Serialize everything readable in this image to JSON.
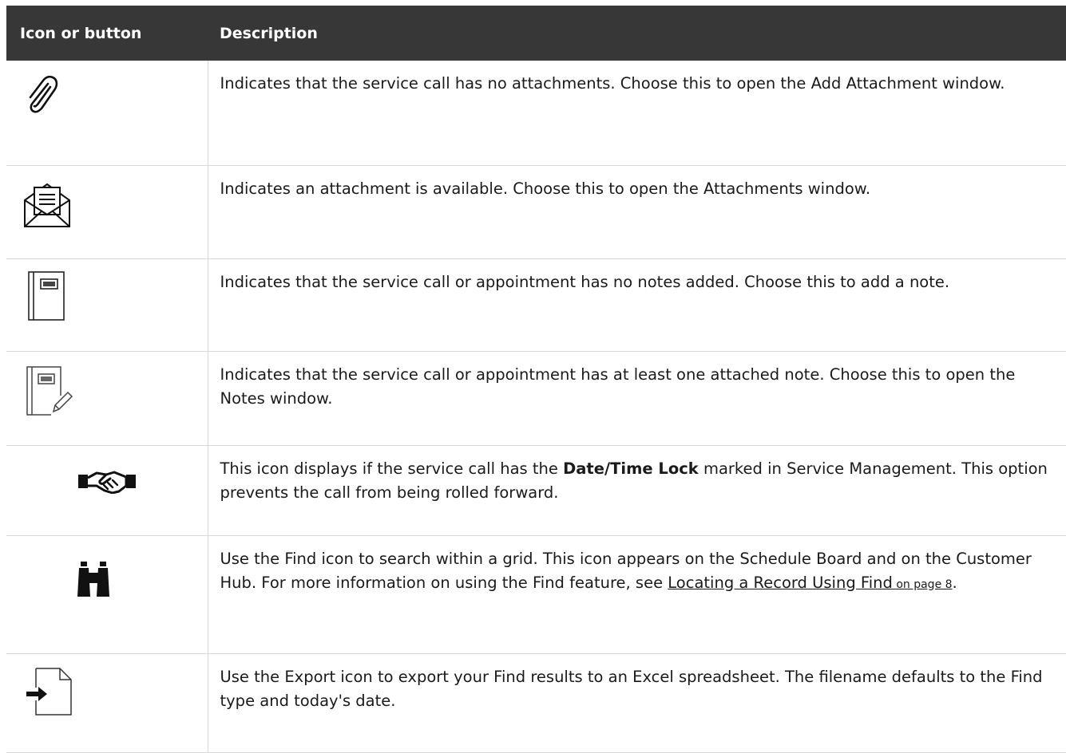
{
  "table": {
    "headers": {
      "icon": "Icon or button",
      "description": "Description"
    },
    "rows": [
      {
        "icon": "paperclip-icon",
        "description": "Indicates that the service call has no attachments. Choose this to open the Add Attachment window."
      },
      {
        "icon": "open-envelope-document-icon",
        "description": "Indicates an attachment is available. Choose this to open the Attachments window."
      },
      {
        "icon": "notebook-icon",
        "description": "Indicates that the service call or appointment has no notes added. Choose this to add a note."
      },
      {
        "icon": "notebook-pencil-icon",
        "description": "Indicates that the service call or appointment has at least one attached note. Choose this to open the Notes window."
      },
      {
        "icon": "handshake-icon",
        "description_before": "This icon displays if the service call has the ",
        "description_bold": "Date/Time Lock",
        "description_after": " marked in Service Management. This option prevents the call from being rolled forward."
      },
      {
        "icon": "binoculars-icon",
        "description_before": "Use the Find icon to search within a grid. This icon appears on the Schedule Board and on the Customer Hub. For more information on using the Find feature, see ",
        "link_text": "Locating a Record Using Find",
        "link_page": " on page 8",
        "description_after": "."
      },
      {
        "icon": "export-document-arrow-icon",
        "description": "Use the Export icon to export your Find results to an Excel spreadsheet. The filename defaults to the Find type and today's date."
      }
    ]
  }
}
